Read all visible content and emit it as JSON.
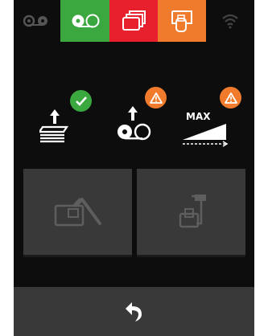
{
  "status_bar": {
    "items": [
      {
        "name": "ink-cartridge",
        "state": "inactive",
        "color": "#555555"
      },
      {
        "name": "ribbon",
        "state": "ok",
        "color": "#3aa73f"
      },
      {
        "name": "cards",
        "state": "error",
        "color": "#e8202e"
      },
      {
        "name": "card-feeder",
        "state": "warning",
        "color": "#f07b2c"
      },
      {
        "name": "wifi",
        "state": "inactive",
        "color": "#555555"
      }
    ]
  },
  "status_icons": {
    "card_input": {
      "badge": "check",
      "badge_color": "#3aa73f"
    },
    "ribbon": {
      "badge": "warning",
      "badge_color": "#f07b2c"
    },
    "card_output": {
      "label": "MAX",
      "badge": "warning",
      "badge_color": "#f07b2c"
    }
  },
  "actions": {
    "clean": {
      "icon": "card-cleaning-pen-icon",
      "enabled": false
    },
    "rotate": {
      "icon": "card-flipper-icon",
      "enabled": false
    }
  },
  "navigation": {
    "back": {
      "icon": "back-arrow-icon"
    }
  }
}
